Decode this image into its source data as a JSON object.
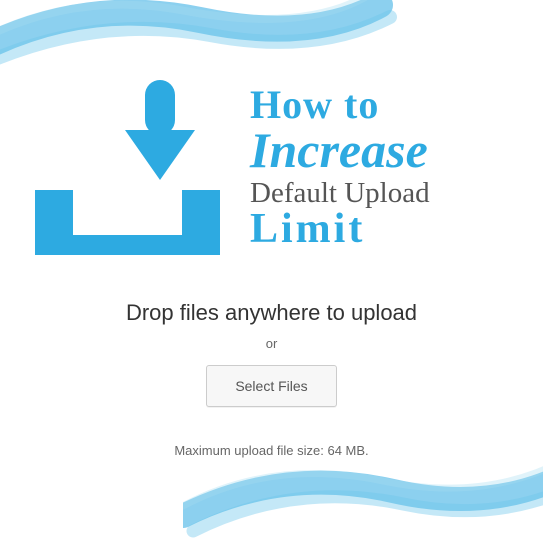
{
  "hero": {
    "line1": "How to",
    "line2": "Increase",
    "line3": "Default Upload",
    "line4": "Limit"
  },
  "uploader": {
    "drop_text": "Drop files anywhere to upload",
    "or_text": "or",
    "select_button": "Select Files",
    "max_text": "Maximum upload file size: 64 MB."
  },
  "colors": {
    "accent": "#2daae1"
  }
}
